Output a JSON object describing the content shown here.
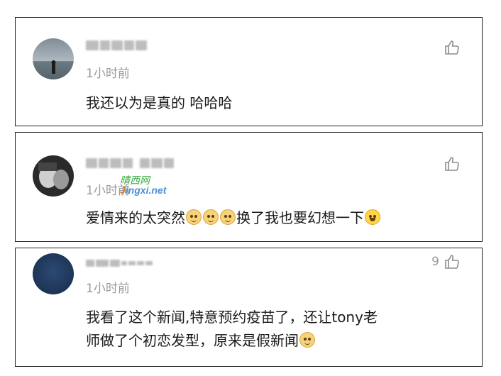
{
  "comments": [
    {
      "time": "1小时前",
      "content_parts": [
        "我还以为是真的  哈哈哈"
      ],
      "like_count": ""
    },
    {
      "time": "1小时前",
      "content_parts": [
        "爱情来的太突然",
        "换了我也要幻想一下"
      ],
      "emojis": [
        "dog-face-emoji",
        "dog-face-emoji",
        "dog-face-emoji",
        "laughing-tears-emoji"
      ],
      "like_count": ""
    },
    {
      "time": "1小时前",
      "content_line1": "我看了这个新闻,特意预约疫苗了，还让tony老",
      "content_line2": "师做了个初恋发型，原来是假新闻",
      "emojis": [
        "dog-face-emoji"
      ],
      "like_count": "9"
    }
  ],
  "watermark": {
    "top": "晴西网",
    "bottom_j": "J",
    "bottom_rest": "ingxi.net"
  },
  "icons": {
    "like": "thumbs-up-icon"
  }
}
